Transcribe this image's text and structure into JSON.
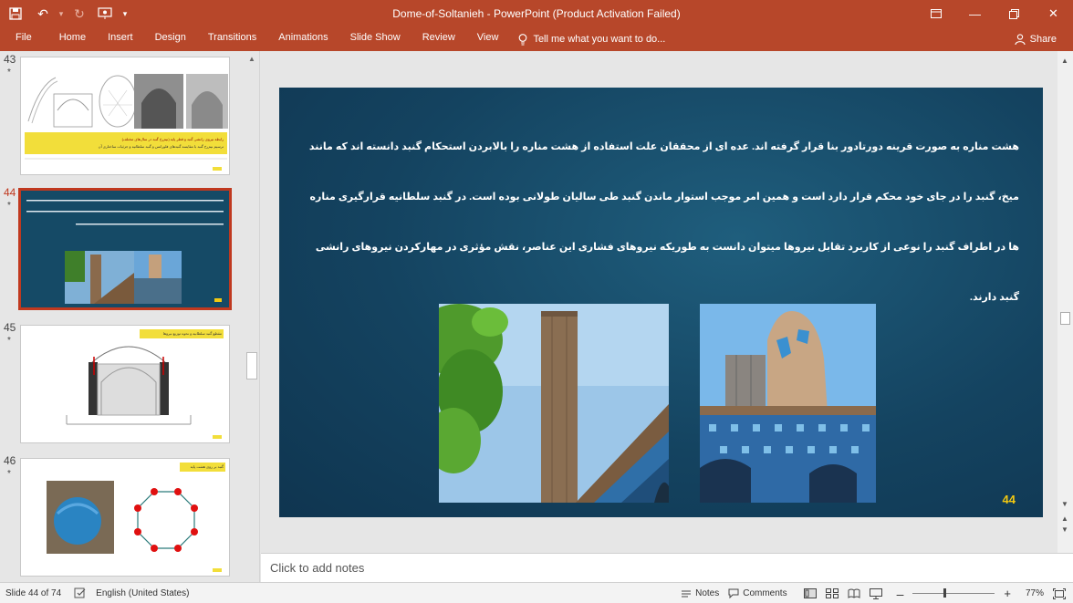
{
  "window": {
    "title": "Dome-of-Soltanieh - PowerPoint (Product Activation Failed)",
    "accent_color": "#b7472a"
  },
  "quick_access": {
    "save_icon": "save-icon",
    "undo_icon": "undo-icon",
    "redo_icon": "redo-icon",
    "present_icon": "present-from-start-icon",
    "customize_icon": "customize-qat-icon"
  },
  "ribbon": {
    "tabs": [
      "File",
      "Home",
      "Insert",
      "Design",
      "Transitions",
      "Animations",
      "Slide Show",
      "Review",
      "View"
    ],
    "tell_me": "Tell me what you want to do...",
    "share": "Share"
  },
  "thumbnails": [
    {
      "number": "43",
      "star": "*",
      "caption_line1": "رابطه نیروی رانشی گنبد و قطر پایه (نیم‌رخ گنبد در سال‌های مختلف)",
      "caption_line2": "ترسیم نیم‌رخ گنبد با مقایسه گنبدهای فلورانس و گنبد سلطانیه و جزئیات ساختاری آن"
    },
    {
      "number": "44",
      "star": "*",
      "selected": true,
      "footer": "44"
    },
    {
      "number": "45",
      "star": "*",
      "caption": "مقطع گنبد سلطانیه و نحوه توزیع نیروها"
    },
    {
      "number": "46",
      "star": "*",
      "caption": "گنبد بر روی هشت پایه"
    }
  ],
  "slide": {
    "body_text": "هشت مناره به صورت قرینه دورتادور بنا قرار گرفته اند. عده ای از محققان علت استفاده از هشت مناره را بالابردن استحکام گنبد دانسته اند که مانند میخ، گنبد را در جای خود محکم قرار دارد است و همین امر موجب استوار ماندن گنبد طی سالیان طولانی بوده است. در گنبد سلطانیه قرارگیری مناره ها در اطراف گنبد را نوعی از کاربرد تقابل نیروها میتوان دانست به طوریکه نیروهای فشاری این عناصر، نقش مؤثری در مهارکردن نیروهای رانشی گنبد دارند.",
    "slide_number": "44",
    "number_color": "#f2c811"
  },
  "notes": {
    "placeholder": "Click to add notes"
  },
  "status": {
    "slide_info": "Slide 44 of 74",
    "language": "English (United States)",
    "notes_label": "Notes",
    "comments_label": "Comments",
    "zoom": "77%"
  }
}
